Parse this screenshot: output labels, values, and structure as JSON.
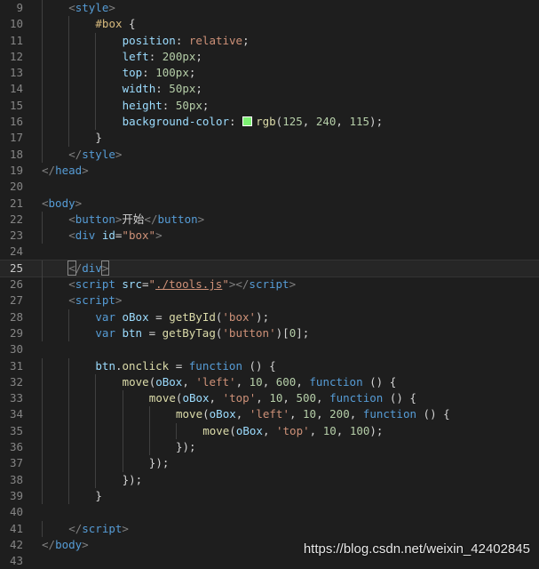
{
  "editor": {
    "current_line": 25,
    "lines": [
      {
        "n": "9",
        "indent": 1,
        "tokens": [
          [
            "punc",
            "<"
          ],
          [
            "tag",
            "style"
          ],
          [
            "punc",
            ">"
          ]
        ]
      },
      {
        "n": "10",
        "indent": 2,
        "tokens": [
          [
            "sel",
            "#box"
          ],
          [
            "text",
            " {"
          ]
        ]
      },
      {
        "n": "11",
        "indent": 3,
        "tokens": [
          [
            "attr",
            "position"
          ],
          [
            "text",
            ": "
          ],
          [
            "val",
            "relative"
          ],
          [
            "text",
            ";"
          ]
        ]
      },
      {
        "n": "12",
        "indent": 3,
        "tokens": [
          [
            "attr",
            "left"
          ],
          [
            "text",
            ": "
          ],
          [
            "num",
            "200px"
          ],
          [
            "text",
            ";"
          ]
        ]
      },
      {
        "n": "13",
        "indent": 3,
        "tokens": [
          [
            "attr",
            "top"
          ],
          [
            "text",
            ": "
          ],
          [
            "num",
            "100px"
          ],
          [
            "text",
            ";"
          ]
        ]
      },
      {
        "n": "14",
        "indent": 3,
        "tokens": [
          [
            "attr",
            "width"
          ],
          [
            "text",
            ": "
          ],
          [
            "num",
            "50px"
          ],
          [
            "text",
            ";"
          ]
        ]
      },
      {
        "n": "15",
        "indent": 3,
        "tokens": [
          [
            "attr",
            "height"
          ],
          [
            "text",
            ": "
          ],
          [
            "num",
            "50px"
          ],
          [
            "text",
            ";"
          ]
        ]
      },
      {
        "n": "16",
        "indent": 3,
        "tokens": [
          [
            "attr",
            "background-color"
          ],
          [
            "text",
            ": "
          ],
          [
            "swatch",
            ""
          ],
          [
            "fn",
            "rgb"
          ],
          [
            "text",
            "("
          ],
          [
            "num",
            "125"
          ],
          [
            "text",
            ", "
          ],
          [
            "num",
            "240"
          ],
          [
            "text",
            ", "
          ],
          [
            "num",
            "115"
          ],
          [
            "text",
            ");"
          ]
        ]
      },
      {
        "n": "17",
        "indent": 2,
        "tokens": [
          [
            "text",
            "}"
          ]
        ]
      },
      {
        "n": "18",
        "indent": 1,
        "tokens": [
          [
            "punc",
            "</"
          ],
          [
            "tag",
            "style"
          ],
          [
            "punc",
            ">"
          ]
        ]
      },
      {
        "n": "19",
        "indent": 0,
        "tokens": [
          [
            "punc",
            "</"
          ],
          [
            "tag",
            "head"
          ],
          [
            "punc",
            ">"
          ]
        ]
      },
      {
        "n": "20",
        "indent": 0,
        "tokens": []
      },
      {
        "n": "21",
        "indent": 0,
        "tokens": [
          [
            "punc",
            "<"
          ],
          [
            "tag",
            "body"
          ],
          [
            "punc",
            ">"
          ]
        ]
      },
      {
        "n": "22",
        "indent": 1,
        "tokens": [
          [
            "punc",
            "<"
          ],
          [
            "tag",
            "button"
          ],
          [
            "punc",
            ">"
          ],
          [
            "text",
            "开始"
          ],
          [
            "punc",
            "</"
          ],
          [
            "tag",
            "button"
          ],
          [
            "punc",
            ">"
          ]
        ]
      },
      {
        "n": "23",
        "indent": 1,
        "tokens": [
          [
            "punc",
            "<"
          ],
          [
            "tag",
            "div"
          ],
          [
            "text",
            " "
          ],
          [
            "attr",
            "id"
          ],
          [
            "text",
            "="
          ],
          [
            "str",
            "\"box\""
          ],
          [
            "punc",
            ">"
          ]
        ]
      },
      {
        "n": "24",
        "indent": 0,
        "tokens": []
      },
      {
        "n": "25",
        "indent": 1,
        "tokens": [
          [
            "box",
            "<"
          ],
          [
            "punc",
            "/"
          ],
          [
            "tag",
            "div"
          ],
          [
            "box",
            ">"
          ]
        ]
      },
      {
        "n": "26",
        "indent": 1,
        "tokens": [
          [
            "punc",
            "<"
          ],
          [
            "tag",
            "script"
          ],
          [
            "text",
            " "
          ],
          [
            "attr",
            "src"
          ],
          [
            "text",
            "="
          ],
          [
            "str",
            "\""
          ],
          [
            "link",
            "./tools.js"
          ],
          [
            "str",
            "\""
          ],
          [
            "punc",
            "></"
          ],
          [
            "tag",
            "script"
          ],
          [
            "punc",
            ">"
          ]
        ]
      },
      {
        "n": "27",
        "indent": 1,
        "tokens": [
          [
            "punc",
            "<"
          ],
          [
            "tag",
            "script"
          ],
          [
            "punc",
            ">"
          ]
        ]
      },
      {
        "n": "28",
        "indent": 2,
        "tokens": [
          [
            "kw",
            "var"
          ],
          [
            "text",
            " "
          ],
          [
            "attr",
            "oBox"
          ],
          [
            "text",
            " = "
          ],
          [
            "fn",
            "getById"
          ],
          [
            "text",
            "("
          ],
          [
            "str",
            "'box'"
          ],
          [
            "text",
            ");"
          ]
        ]
      },
      {
        "n": "29",
        "indent": 2,
        "tokens": [
          [
            "kw",
            "var"
          ],
          [
            "text",
            " "
          ],
          [
            "attr",
            "btn"
          ],
          [
            "text",
            " = "
          ],
          [
            "fn",
            "getByTag"
          ],
          [
            "text",
            "("
          ],
          [
            "str",
            "'button'"
          ],
          [
            "text",
            ")["
          ],
          [
            "num",
            "0"
          ],
          [
            "text",
            "];"
          ]
        ]
      },
      {
        "n": "30",
        "indent": 0,
        "tokens": []
      },
      {
        "n": "31",
        "indent": 2,
        "tokens": [
          [
            "attr",
            "btn"
          ],
          [
            "text",
            "."
          ],
          [
            "fn",
            "onclick"
          ],
          [
            "text",
            " = "
          ],
          [
            "kw",
            "function"
          ],
          [
            "text",
            " () {"
          ]
        ]
      },
      {
        "n": "32",
        "indent": 3,
        "tokens": [
          [
            "fn",
            "move"
          ],
          [
            "text",
            "("
          ],
          [
            "attr",
            "oBox"
          ],
          [
            "text",
            ", "
          ],
          [
            "str",
            "'left'"
          ],
          [
            "text",
            ", "
          ],
          [
            "num",
            "10"
          ],
          [
            "text",
            ", "
          ],
          [
            "num",
            "600"
          ],
          [
            "text",
            ", "
          ],
          [
            "kw",
            "function"
          ],
          [
            "text",
            " () {"
          ]
        ]
      },
      {
        "n": "33",
        "indent": 4,
        "tokens": [
          [
            "fn",
            "move"
          ],
          [
            "text",
            "("
          ],
          [
            "attr",
            "oBox"
          ],
          [
            "text",
            ", "
          ],
          [
            "str",
            "'top'"
          ],
          [
            "text",
            ", "
          ],
          [
            "num",
            "10"
          ],
          [
            "text",
            ", "
          ],
          [
            "num",
            "500"
          ],
          [
            "text",
            ", "
          ],
          [
            "kw",
            "function"
          ],
          [
            "text",
            " () {"
          ]
        ]
      },
      {
        "n": "34",
        "indent": 5,
        "tokens": [
          [
            "fn",
            "move"
          ],
          [
            "text",
            "("
          ],
          [
            "attr",
            "oBox"
          ],
          [
            "text",
            ", "
          ],
          [
            "str",
            "'left'"
          ],
          [
            "text",
            ", "
          ],
          [
            "num",
            "10"
          ],
          [
            "text",
            ", "
          ],
          [
            "num",
            "200"
          ],
          [
            "text",
            ", "
          ],
          [
            "kw",
            "function"
          ],
          [
            "text",
            " () {"
          ]
        ]
      },
      {
        "n": "35",
        "indent": 6,
        "tokens": [
          [
            "fn",
            "move"
          ],
          [
            "text",
            "("
          ],
          [
            "attr",
            "oBox"
          ],
          [
            "text",
            ", "
          ],
          [
            "str",
            "'top'"
          ],
          [
            "text",
            ", "
          ],
          [
            "num",
            "10"
          ],
          [
            "text",
            ", "
          ],
          [
            "num",
            "100"
          ],
          [
            "text",
            ");"
          ]
        ]
      },
      {
        "n": "36",
        "indent": 5,
        "tokens": [
          [
            "text",
            "});"
          ]
        ]
      },
      {
        "n": "37",
        "indent": 4,
        "tokens": [
          [
            "text",
            "});"
          ]
        ]
      },
      {
        "n": "38",
        "indent": 3,
        "tokens": [
          [
            "text",
            "});"
          ]
        ]
      },
      {
        "n": "39",
        "indent": 2,
        "tokens": [
          [
            "text",
            "}"
          ]
        ]
      },
      {
        "n": "40",
        "indent": 0,
        "tokens": []
      },
      {
        "n": "41",
        "indent": 1,
        "tokens": [
          [
            "punc",
            "</"
          ],
          [
            "tag",
            "script"
          ],
          [
            "punc",
            ">"
          ]
        ]
      },
      {
        "n": "42",
        "indent": 0,
        "tokens": [
          [
            "punc",
            "</"
          ],
          [
            "tag",
            "body"
          ],
          [
            "punc",
            ">"
          ]
        ]
      },
      {
        "n": "43",
        "indent": 0,
        "tokens": []
      }
    ]
  },
  "colors": {
    "background": "#1e1e1e",
    "swatch": "#7df073"
  },
  "watermark": "https://blog.csdn.net/weixin_42402845"
}
